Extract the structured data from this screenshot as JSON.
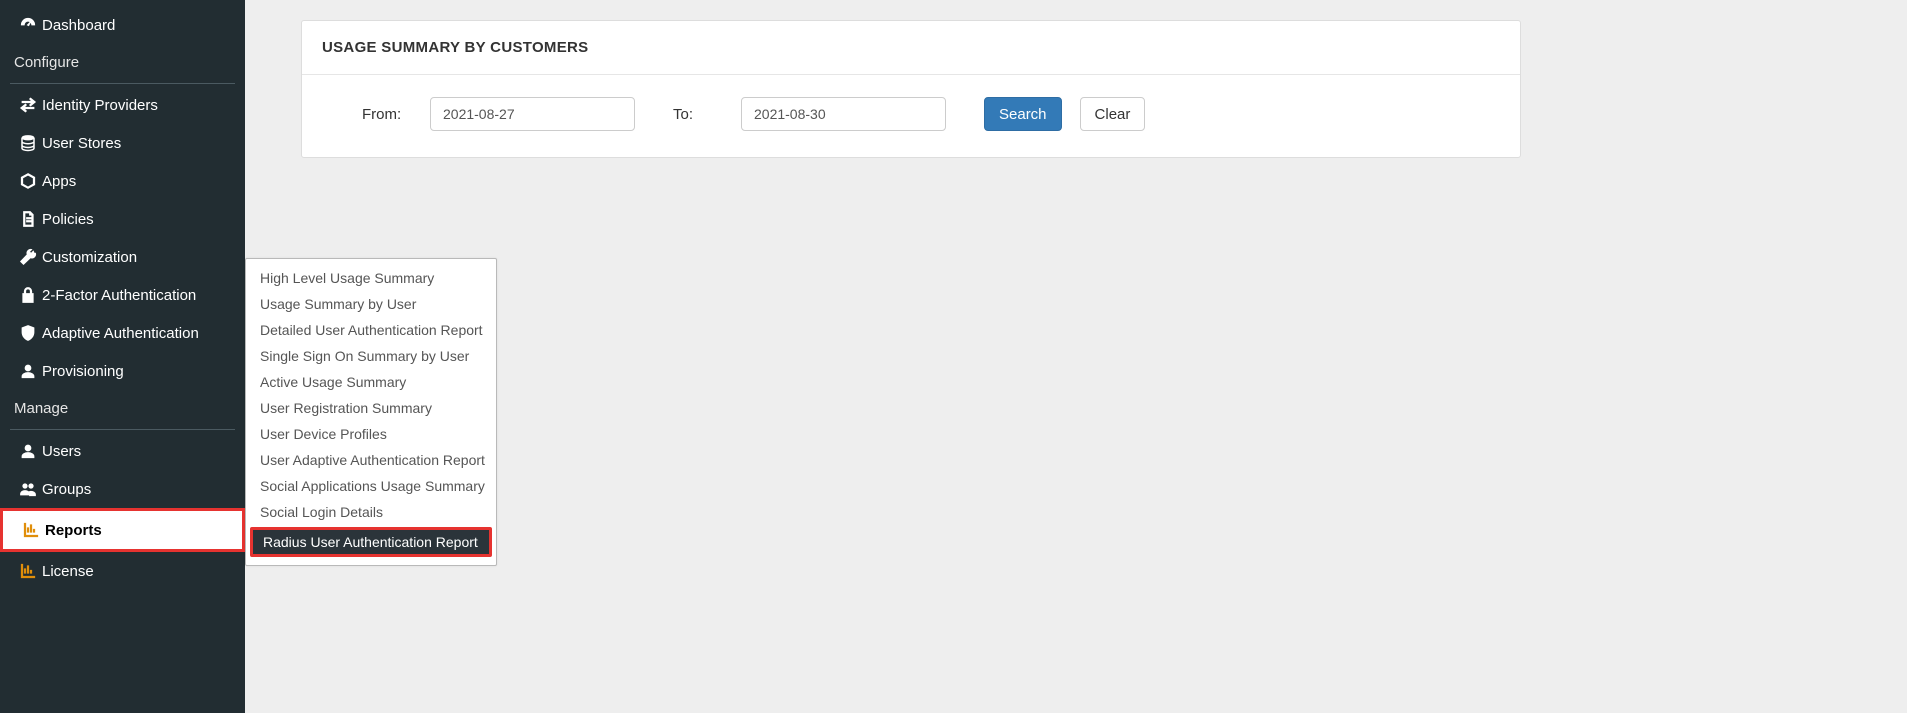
{
  "sidebar": {
    "dashboard": "Dashboard",
    "section_configure": "Configure",
    "identity_providers": "Identity Providers",
    "user_stores": "User Stores",
    "apps": "Apps",
    "policies": "Policies",
    "customization": "Customization",
    "two_factor": "2-Factor Authentication",
    "adaptive_auth": "Adaptive Authentication",
    "provisioning": "Provisioning",
    "section_manage": "Manage",
    "users": "Users",
    "groups": "Groups",
    "reports": "Reports",
    "license": "License"
  },
  "panel": {
    "title": "USAGE SUMMARY BY CUSTOMERS",
    "from_label": "From:",
    "to_label": "To:",
    "from_value": "2021-08-27",
    "to_value": "2021-08-30",
    "search": "Search",
    "clear": "Clear"
  },
  "flyout": {
    "items": [
      "High Level Usage Summary",
      "Usage Summary by User",
      "Detailed User Authentication Report",
      "Single Sign On Summary by User",
      "Active Usage Summary",
      "User Registration Summary",
      "User Device Profiles",
      "User Adaptive Authentication Report",
      "Social Applications Usage Summary",
      "Social Login Details",
      "Radius User Authentication Report"
    ]
  }
}
